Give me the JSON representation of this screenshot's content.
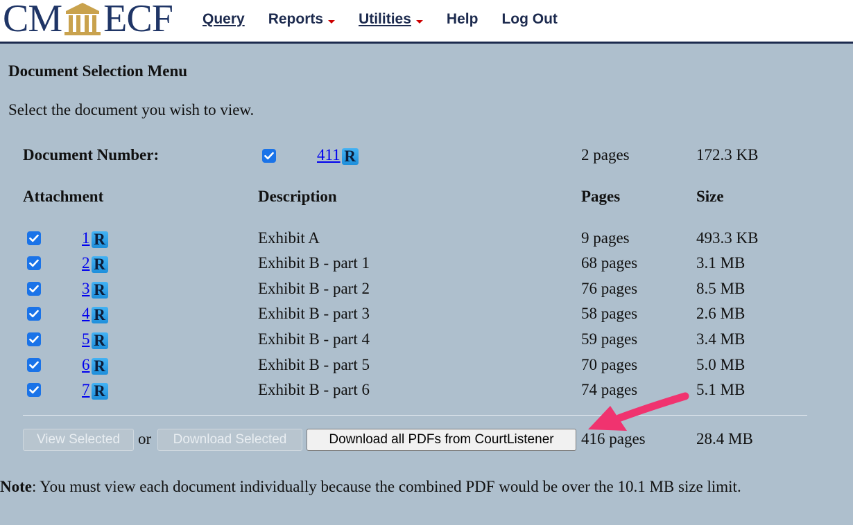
{
  "header": {
    "logo_left": "CM",
    "logo_right": "ECF",
    "nav": {
      "query": "Query",
      "reports": "Reports",
      "utilities": "Utilities",
      "help": "Help",
      "logout": "Log Out"
    }
  },
  "main": {
    "title": "Document Selection Menu",
    "subtitle": "Select the document you wish to view.",
    "document": {
      "label": "Document Number:",
      "number": "411",
      "pages": "2 pages",
      "size": "172.3 KB",
      "checked": true
    },
    "columns": {
      "attachment": "Attachment",
      "description": "Description",
      "pages": "Pages",
      "size": "Size"
    },
    "attachments": [
      {
        "number": "1",
        "description": "Exhibit A",
        "pages": "9 pages",
        "size": "493.3 KB",
        "checked": true
      },
      {
        "number": "2",
        "description": "Exhibit B - part 1",
        "pages": "68 pages",
        "size": "3.1 MB",
        "checked": true
      },
      {
        "number": "3",
        "description": "Exhibit B - part 2",
        "pages": "76 pages",
        "size": "8.5 MB",
        "checked": true
      },
      {
        "number": "4",
        "description": "Exhibit B - part 3",
        "pages": "58 pages",
        "size": "2.6 MB",
        "checked": true
      },
      {
        "number": "5",
        "description": "Exhibit B - part 4",
        "pages": "59 pages",
        "size": "3.4 MB",
        "checked": true
      },
      {
        "number": "6",
        "description": "Exhibit B - part 5",
        "pages": "70 pages",
        "size": "5.0 MB",
        "checked": true
      },
      {
        "number": "7",
        "description": "Exhibit B - part 6",
        "pages": "74 pages",
        "size": "5.1 MB",
        "checked": true
      }
    ],
    "recap_badge": "R",
    "footer_row": {
      "view_selected": "View Selected",
      "or": "or",
      "download_selected": "Download Selected",
      "download_courtlistener": "Download all PDFs from CourtListener",
      "total_pages": "416 pages",
      "total_size": "28.4 MB"
    },
    "note": {
      "label": "Note",
      "text": ": You must view each document individually because the combined PDF would be over the 10.1 MB size limit."
    }
  },
  "colors": {
    "background": "#aebfcd",
    "header_text": "#1c2a4e",
    "logo": "#1f3566",
    "link": "#0000ee",
    "checkbox": "#1a73e8",
    "caret": "#cc0000",
    "annotation_arrow": "#f0336f"
  },
  "icons": {
    "logo": "courthouse-columns-icon",
    "checkbox": "checkmark-icon",
    "recap": "recap-r-icon",
    "annotation": "pink-arrow-icon"
  }
}
